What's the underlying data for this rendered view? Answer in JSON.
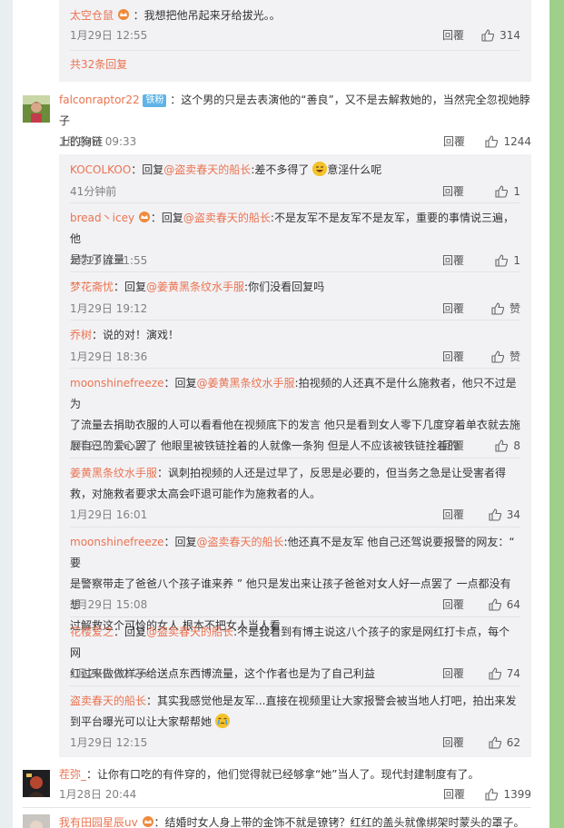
{
  "ui": {
    "reply_label": "回覆",
    "like_icon": "thumbs-up-icon"
  },
  "top_thread_tail": {
    "reply": {
      "user": "太空仓鼠",
      "text": "：我想把他吊起来牙给拔光。。",
      "time": "1月29日 12:55",
      "likes": "314"
    },
    "more_replies": "共32条回复"
  },
  "comments": [
    {
      "user": "falconraptor22",
      "badge": "铁粉",
      "text_line1": "：这个男的只是去表演他的“善良”，又不是去解救她的，当然完全忽视她脖子",
      "text_line2": "上的狗链",
      "time": "1月29日 09:33",
      "likes": "1244",
      "replies": [
        {
          "user": "KOCOLKOO",
          "pre": "：回复",
          "mention": "@盗卖春天的船长",
          "text": ":差不多得了",
          "text_after_emoji": "意淫什么呢",
          "time": "41分钟前",
          "likes": "1"
        },
        {
          "user": "bread丶icey",
          "pre": "：回复",
          "mention": "@盗卖春天的船长",
          "text": ":不是友军不是友军不是友军，重要的事情说三遍，他",
          "text2": "是为了流量",
          "time": "1月29日 21:55",
          "likes": "1"
        },
        {
          "user": "梦花斋忧",
          "pre": "：回复",
          "mention": "@姜黄黑条纹水手服",
          "text": ":你们没看回复吗",
          "time": "1月29日 19:12",
          "likes": "赞"
        },
        {
          "user": "乔树",
          "text": "：说的对！演戏！",
          "time": "1月29日 18:36",
          "likes": "赞"
        },
        {
          "user": "moonshinefreeze",
          "pre": "：回复",
          "mention": "@姜黄黑条纹水手服",
          "text": ":拍视频的人还真不是什么施救者，他只不过是为",
          "text2": "了流量去捐助衣服的人可以看看他在视频底下的发言 他只是看到女人零下几度穿着单衣就去施",
          "text3": "展自己的爱心罢了 他眼里被铁链拴着的人就像一条狗 但是人不应该被铁链拴着的",
          "time": "1月29日 16:17",
          "likes": "8"
        },
        {
          "user": "姜黄黑条纹水手服",
          "text": "：讽刺拍视频的人还是过早了，反思是必要的，但当务之急是让受害者得",
          "text2": "救，对施救者要求太高会吓退可能作为施救者的人。",
          "time": "1月29日 16:01",
          "likes": "34"
        },
        {
          "user": "moonshinefreeze",
          "pre": "：回复",
          "mention": "@盗卖春天的船长",
          "text": ":他还真不是友军 他自己还驾说要报警的网友：“ 要",
          "text2": "是警察带走了爸爸八个孩子谁来养 ” 他只是发出来让孩子爸爸对女人好一点罢了 一点都没有想",
          "text3": "过解救这个可怜的女人 根本不把女人当人看",
          "time": "1月29日 15:08",
          "likes": "64"
        },
        {
          "user": "花楼爱之",
          "pre": "：回复",
          "mention": "@盗卖春天的船长",
          "text": ":不是我看到有博主说这八个孩子的家是网红打卡点，每个网",
          "text2": "红过来做做样子给送点东西博流量，这个作者也是为了自己利益",
          "time": "1月29日 12:26",
          "likes": "74"
        },
        {
          "user": "盗卖春天的船长",
          "text": "：其实我感觉他是友军...直接在视频里让大家报警会被当地人打吧，拍出来发",
          "text2": "到平台曝光可以让大家帮帮她",
          "time": "1月29日 12:15",
          "likes": "62"
        }
      ]
    },
    {
      "user": "茬弥_",
      "text_line1": "：让你有口吃的有件穿的，他们觉得就已经够拿“她”当人了。现代封建制度有了。",
      "time": "1月28日 20:44",
      "likes": "1399"
    },
    {
      "user": "我有田园星辰uv",
      "text_line1": "：结婚时女人身上带的金饰不就是镣铐？红红的盖头就像绑架时蒙头的罩子。"
    }
  ]
}
